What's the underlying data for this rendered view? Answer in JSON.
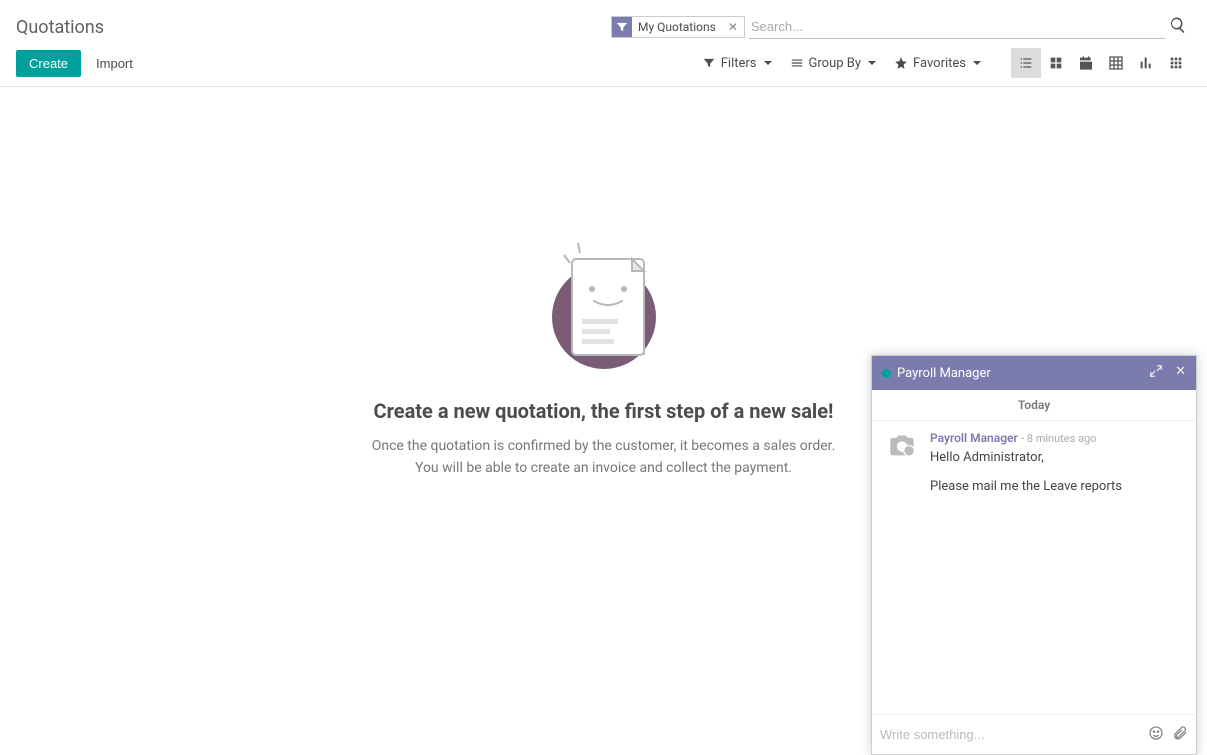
{
  "page_title": "Quotations",
  "search": {
    "facet_label": "My Quotations",
    "placeholder": "Search..."
  },
  "actions": {
    "create": "Create",
    "import": "Import"
  },
  "search_options": {
    "filters": "Filters",
    "group_by": "Group By",
    "favorites": "Favorites"
  },
  "empty": {
    "title": "Create a new quotation, the first step of a new sale!",
    "line1": "Once the quotation is confirmed by the customer, it becomes a sales order.",
    "line2": "You will be able to create an invoice and collect the payment."
  },
  "chat": {
    "title": "Payroll Manager",
    "date_label": "Today",
    "message": {
      "author": "Payroll Manager",
      "time": "- 8 minutes ago",
      "line1": "Hello Administrator,",
      "line2": "Please mail me the Leave reports"
    },
    "input_placeholder": "Write something..."
  }
}
